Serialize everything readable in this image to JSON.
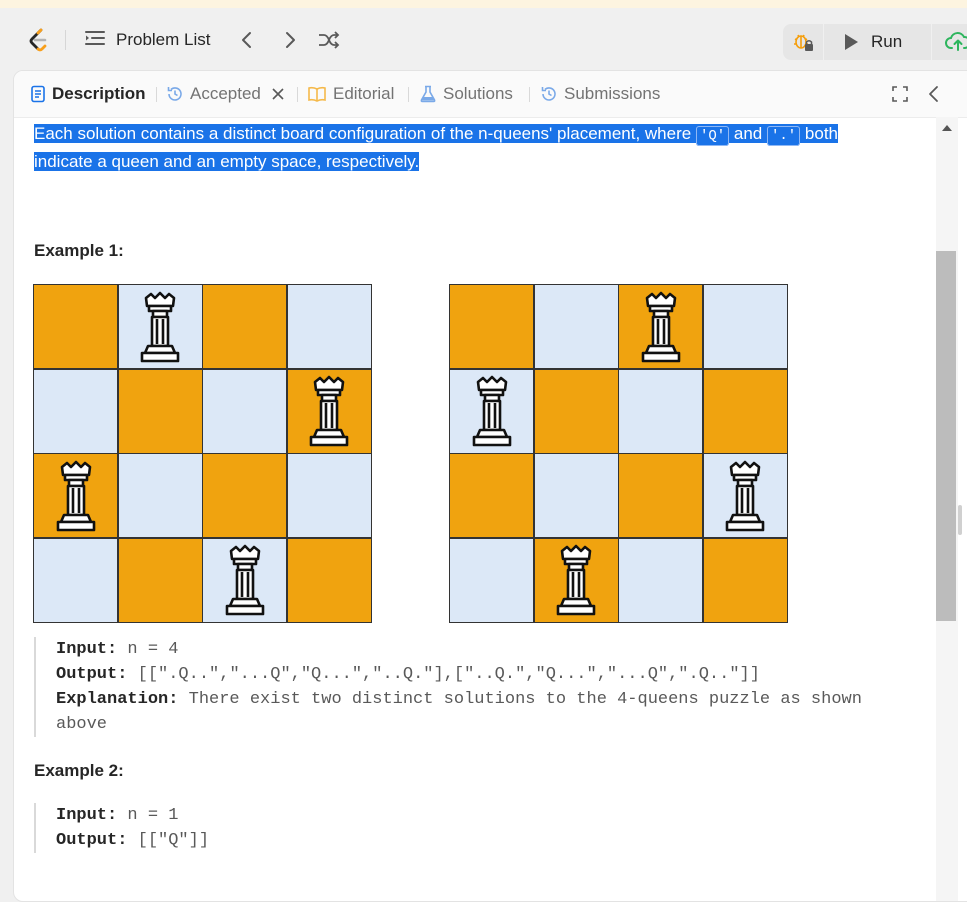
{
  "nav": {
    "problem_list_label": "Problem List",
    "run_label": "Run"
  },
  "tabs": [
    {
      "label": "Description",
      "active": true
    },
    {
      "label": "Accepted",
      "active": false
    },
    {
      "label": "Editorial",
      "active": false
    },
    {
      "label": "Solutions",
      "active": false
    },
    {
      "label": "Submissions",
      "active": false
    }
  ],
  "content": {
    "selected_text": {
      "part1": "Each solution contains a distinct board configuration of the n-queens' placement, where ",
      "code_q": "'Q'",
      "and": " and ",
      "code_dot": "'.'",
      "part2": " both indicate a queen and an empty space, respectively."
    },
    "example1": {
      "title": "Example 1:",
      "input_key": "Input:",
      "input_value": " n = 4",
      "output_key": "Output:",
      "output_value": " [[\".Q..\",\"...Q\",\"Q...\",\"..Q.\"],[\"..Q.\",\"Q...\",\"...Q\",\".Q..\"]]",
      "explanation_key": "Explanation:",
      "explanation_value": " There exist two distinct solutions to the 4-queens puzzle as shown above"
    },
    "example2": {
      "title": "Example 2:",
      "input_key": "Input:",
      "input_value": " n = 1",
      "output_key": "Output:",
      "output_value": " [[\"Q\"]]"
    }
  },
  "boards": [
    {
      "queens_col_by_row": [
        1,
        3,
        0,
        2
      ]
    },
    {
      "queens_col_by_row": [
        2,
        0,
        3,
        1
      ]
    }
  ],
  "colors": {
    "board_dark": "#f0a30f",
    "board_light": "#dce8f7",
    "selection": "#1a73e8",
    "submit_green": "#2db55d"
  }
}
